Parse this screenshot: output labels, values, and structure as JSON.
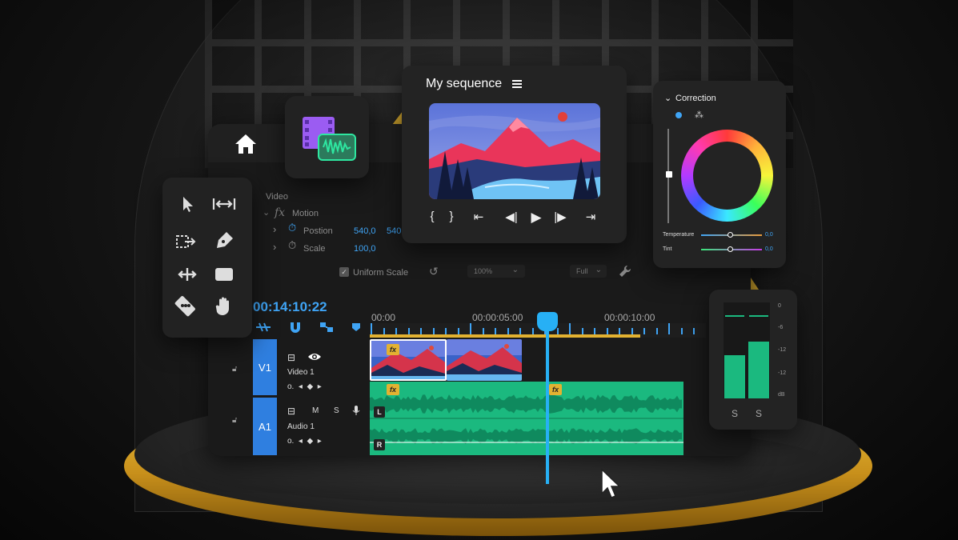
{
  "sequence": {
    "title": "My sequence",
    "controls": [
      "{",
      "}",
      "⇤",
      "◀|",
      "▶",
      "|▶",
      "⇥"
    ]
  },
  "effects": {
    "section": "Video",
    "motion": "Motion",
    "position_label": "Postion",
    "position_x": "540,0",
    "position_y": "540,",
    "scale_label": "Scale",
    "scale_value": "100,0",
    "uniform_scale": "Uniform Scale",
    "zoom": "100%",
    "quality": "Full"
  },
  "timeline": {
    "timecode": "00:14:10:22",
    "ruler": [
      "00:00",
      "00:00:05:00",
      "00:00:10:00"
    ],
    "tracks": [
      {
        "id": "V1",
        "name": "Video 1"
      },
      {
        "id": "A1",
        "name": "Audio 1",
        "m": "M",
        "s": "S"
      }
    ],
    "channels": [
      "L",
      "R"
    ],
    "fx_badge": "fx"
  },
  "color": {
    "title": "Correction",
    "temperature_label": "Temperature",
    "temperature_value": "0,0",
    "tint_label": "Tint",
    "tint_value": "0,0"
  },
  "meter": {
    "db_ticks": [
      "0",
      "-6",
      "-12",
      "-12",
      "dB"
    ],
    "solo": [
      "S",
      "S"
    ],
    "levels": [
      0.55,
      0.72
    ]
  },
  "colors": {
    "accent": "#3fa4f5",
    "audio_green": "#1bb97f",
    "gold": "#e3b231",
    "track_blue": "#2f7fe0"
  },
  "icons": [
    "home-icon",
    "selection-arrow-icon",
    "ripple-edit-icon",
    "track-select-icon",
    "pen-icon",
    "slip-icon",
    "rectangle-icon",
    "razor-icon",
    "hand-icon",
    "snap-icon",
    "marker-icon",
    "eye-icon",
    "mic-icon",
    "wrench-icon",
    "reset-icon"
  ]
}
